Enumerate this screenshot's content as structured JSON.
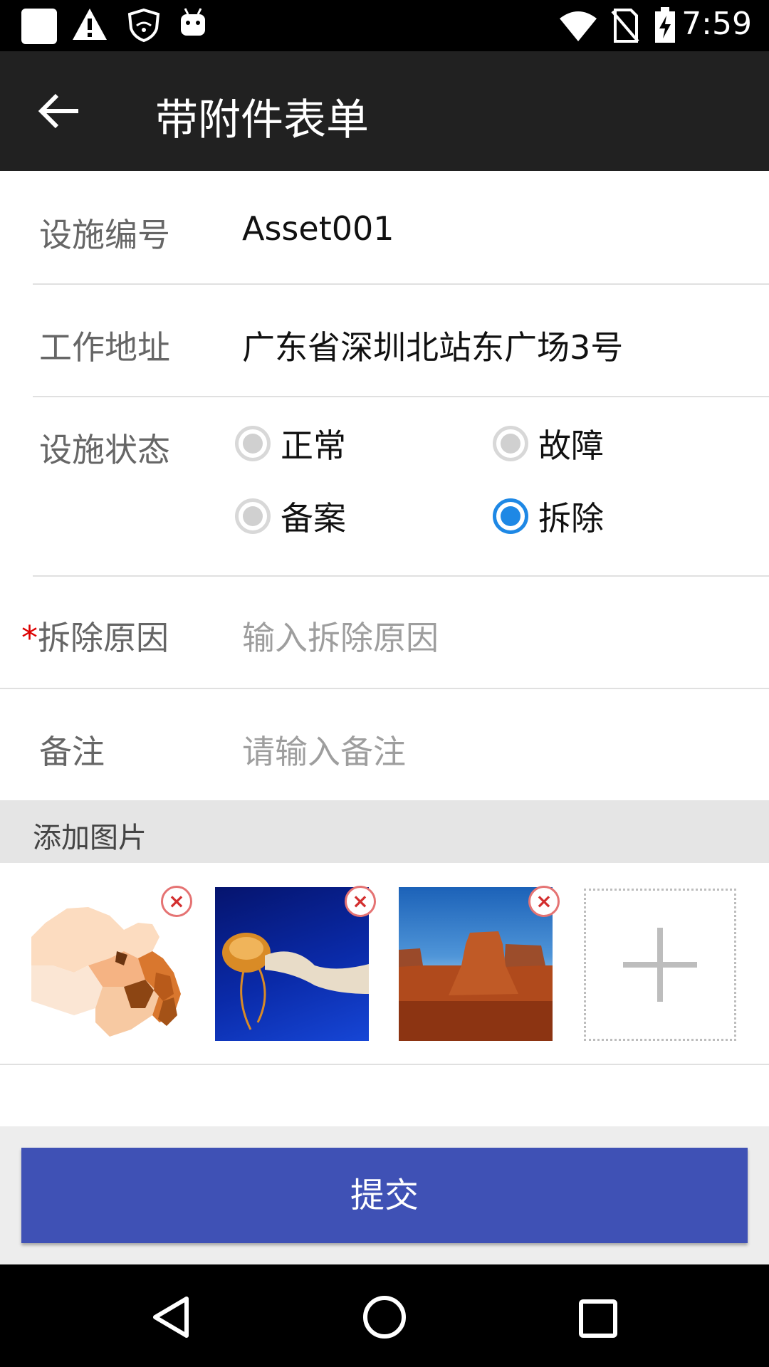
{
  "status_bar": {
    "time": "7:59"
  },
  "app_bar": {
    "title": "带附件表单"
  },
  "form": {
    "asset_no": {
      "label": "设施编号",
      "value": "Asset001"
    },
    "address": {
      "label": "工作地址",
      "value": "广东省深圳北站东广场3号"
    },
    "status": {
      "label": "设施状态",
      "options": [
        "正常",
        "故障",
        "备案",
        "拆除"
      ],
      "selected": "拆除"
    },
    "reason": {
      "required_mark": "*",
      "label": "拆除原因",
      "placeholder": "输入拆除原因"
    },
    "remark": {
      "label": "备注",
      "placeholder": "请输入备注"
    }
  },
  "attachments": {
    "section_title": "添加图片",
    "remove_glyph": "×",
    "images": [
      "china-map-image",
      "jellyfish-image",
      "desert-butte-image"
    ]
  },
  "actions": {
    "submit_label": "提交"
  },
  "colors": {
    "app_bar": "#212121",
    "radio_checked": "#1e88e5",
    "submit": "#3f51b5",
    "required": "#dd0000"
  }
}
